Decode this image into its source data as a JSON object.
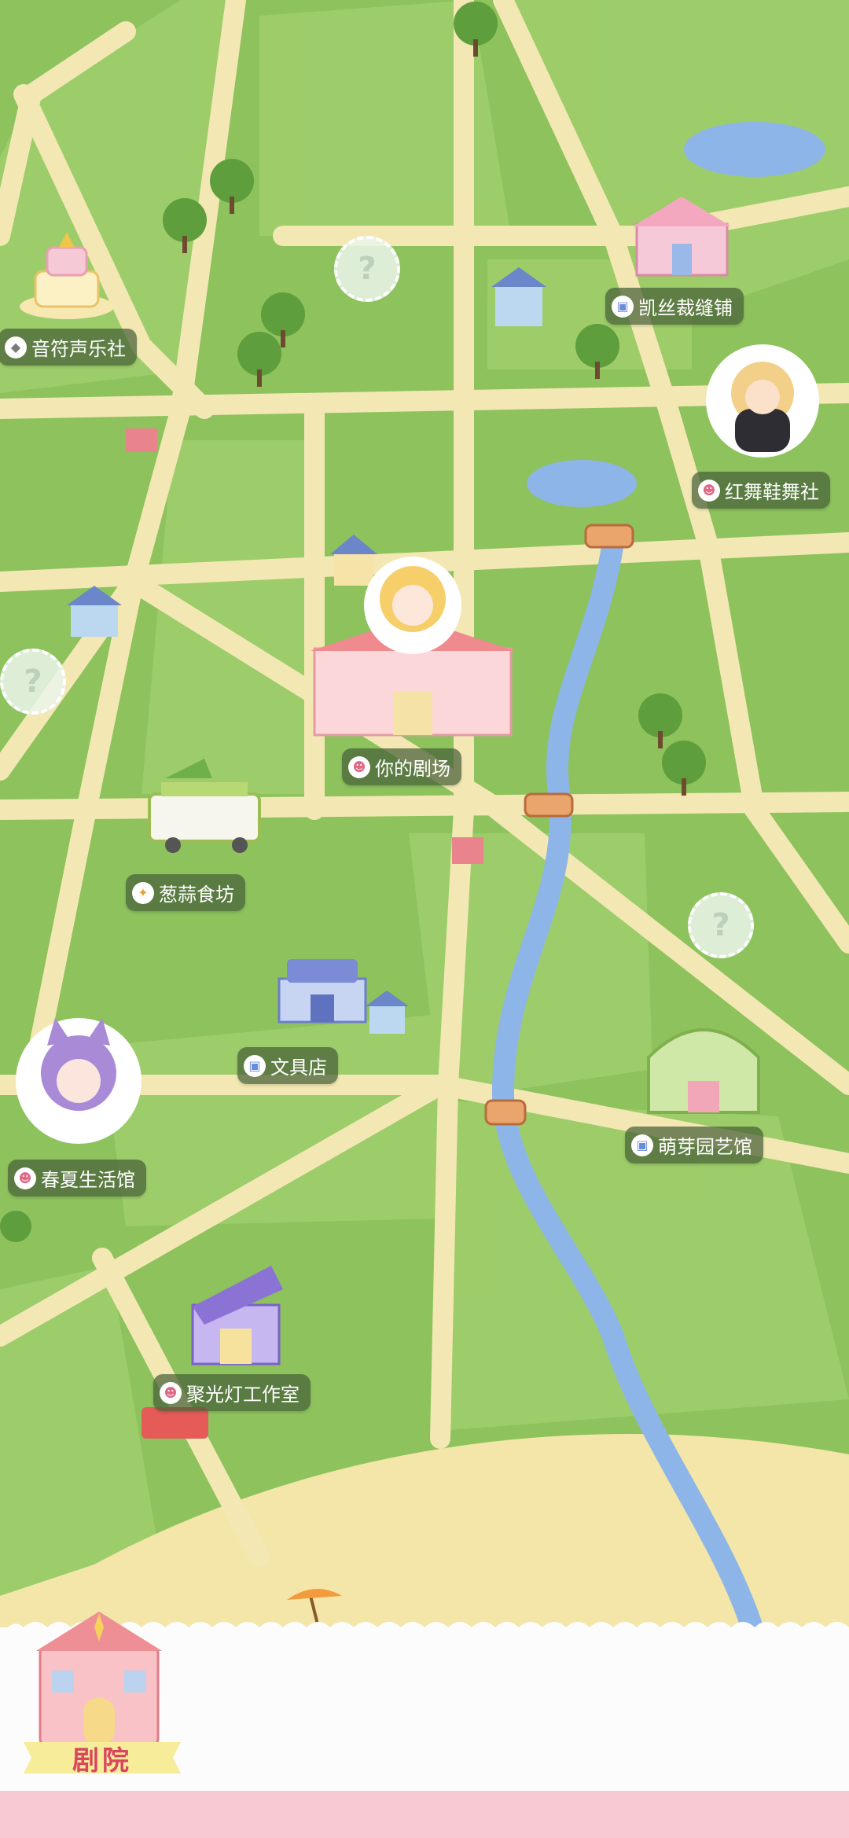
{
  "map": {
    "locations": [
      {
        "id": "music",
        "label": "音符声乐社",
        "icon": "music-icon"
      },
      {
        "id": "tailor",
        "label": "凯丝裁缝铺",
        "icon": "bag-icon"
      },
      {
        "id": "dance",
        "label": "红舞鞋舞社",
        "icon": "theater-icon"
      },
      {
        "id": "theater",
        "label": "你的剧场",
        "icon": "theater-icon"
      },
      {
        "id": "food",
        "label": "葱蒜食坊",
        "icon": "food-icon"
      },
      {
        "id": "stationery",
        "label": "文具店",
        "icon": "bag-icon"
      },
      {
        "id": "life",
        "label": "春夏生活馆",
        "icon": "theater-icon"
      },
      {
        "id": "garden",
        "label": "萌芽园艺馆",
        "icon": "bag-icon"
      },
      {
        "id": "spotlight",
        "label": "聚光灯工作室",
        "icon": "theater-icon"
      }
    ],
    "unknown_marker": "?",
    "colors": {
      "grass": "#8dc25d",
      "road": "#f3e8b4",
      "river": "#8db5e8",
      "beach": "#f3e6a8",
      "accent": "#d9465e"
    }
  },
  "bottom": {
    "tab_label": "剧院"
  }
}
